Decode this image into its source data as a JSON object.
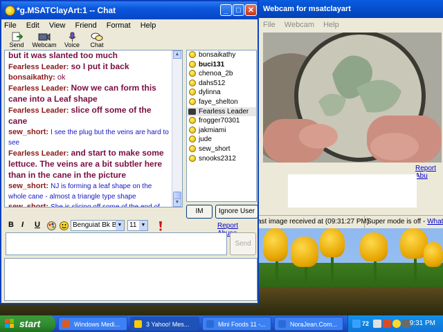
{
  "chat_window": {
    "title": "*g.MSATClayArt:1 -- Chat",
    "menu": [
      "File",
      "Edit",
      "View",
      "Friend",
      "Format",
      "Help"
    ],
    "toolbar": [
      "Send File",
      "Webcam",
      "Voice",
      "Chat"
    ],
    "messages": [
      {
        "who": "",
        "text": "but it was slanted too much",
        "kind": "fl"
      },
      {
        "who": "Fearless Leader:",
        "text": "so I put it back",
        "kind": "fl"
      },
      {
        "who": "bonsaikathy:",
        "text": "ok",
        "kind": "bk"
      },
      {
        "who": "Fearless Leader:",
        "text": "Now we can form this cane into a Leaf shape",
        "kind": "fl"
      },
      {
        "who": "Fearless Leader:",
        "text": "slice off some of the cane",
        "kind": "fl"
      },
      {
        "who": "sew_short:",
        "text": "I see the plug but the veins are hard to see",
        "kind": "ss"
      },
      {
        "who": "Fearless Leader:",
        "text": "and start to make some lettuce. The veins are a bit subtler here than in the cane in the picture",
        "kind": "fl"
      },
      {
        "who": "sew_short:",
        "text": "NJ is forming a leaf shape on the whole cane - almost a triangle type shape",
        "kind": "ss"
      },
      {
        "who": "sew_short:",
        "text": "She is slicing off some of the end of the cane",
        "kind": "ss"
      }
    ],
    "users": [
      {
        "name": "bonsaikathy",
        "icon": "smiley-icon"
      },
      {
        "name": "buci131",
        "icon": "smiley-icon",
        "bold": true
      },
      {
        "name": "chenoa_2b",
        "icon": "smiley-icon"
      },
      {
        "name": "dahs512",
        "icon": "smiley-icon"
      },
      {
        "name": "dylinna",
        "icon": "smiley-icon"
      },
      {
        "name": "faye_shelton",
        "icon": "smiley-icon"
      },
      {
        "name": "Fearless Leader",
        "icon": "webcam-icon",
        "selected": true
      },
      {
        "name": "frogger70301",
        "icon": "smiley-icon"
      },
      {
        "name": "jakmiami",
        "icon": "smiley-icon"
      },
      {
        "name": "jude",
        "icon": "smiley-icon"
      },
      {
        "name": "sew_short",
        "icon": "smiley-icon"
      },
      {
        "name": "snooks2312",
        "icon": "smiley-icon"
      }
    ],
    "im_button": "IM",
    "ignore_button": "Ignore User",
    "format": {
      "bold": "B",
      "italic": "I",
      "underline": "U",
      "font": "Benguiat Bk BT",
      "size": "11"
    },
    "report_abuse": "Report Abuse",
    "send_button": "Send",
    "input_value": ""
  },
  "webcam_window": {
    "title": "Webcam for msatclayart",
    "menu": [
      "File",
      "Webcam",
      "Help"
    ],
    "report_abuse": "Report Abu",
    "status_last_image": "ast image received at (09:31:27 PM)",
    "status_super": "Super mode is off - ",
    "status_link": "What's th"
  },
  "taskbar": {
    "start": "start",
    "buttons": [
      {
        "label": "Windows Medi...",
        "color": "#e05a1a"
      },
      {
        "label": "3 Yahoo! Mes...",
        "color": "#ffcc00",
        "active": true
      },
      {
        "label": "Mini Foods 11 -...",
        "color": "#2b6bd6"
      },
      {
        "label": "NoraJean.Com...",
        "color": "#2b6bd6"
      }
    ],
    "tray_label": "72",
    "clock": "9:31 PM"
  },
  "colors": {
    "title_blue": "#0a56dc",
    "start_green": "#2f8b2f",
    "link": "#0000cc"
  }
}
